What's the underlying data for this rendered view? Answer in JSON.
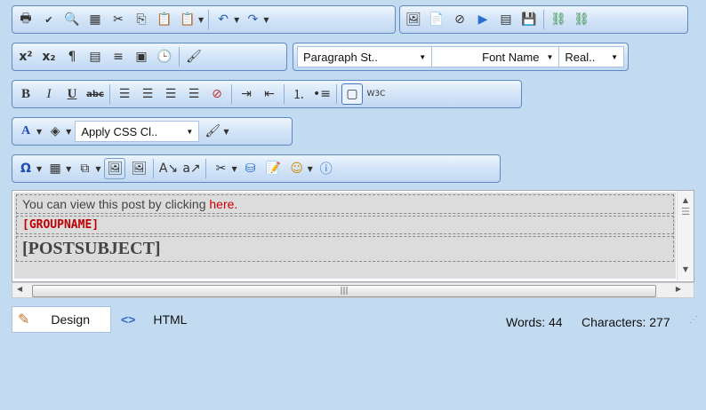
{
  "toolbar": {
    "paragraph_style": "Paragraph St..",
    "font_name": "Font Name",
    "font_size": "Real..",
    "css_class": "Apply CSS Cl.."
  },
  "content": {
    "line1_prefix": "You can view this post by clicking ",
    "line1_link": "here.",
    "groupname": "[GROUPNAME]",
    "postsubject": "[POSTSUBJECT]"
  },
  "status": {
    "design_label": "Design",
    "html_label": "HTML",
    "words": "Words: 44",
    "characters": "Characters: 277"
  },
  "colors": {
    "link": "#cc0000",
    "groupname": "#c00000",
    "toolbar_border": "#5f89c3",
    "background": "#c3dbf1"
  }
}
